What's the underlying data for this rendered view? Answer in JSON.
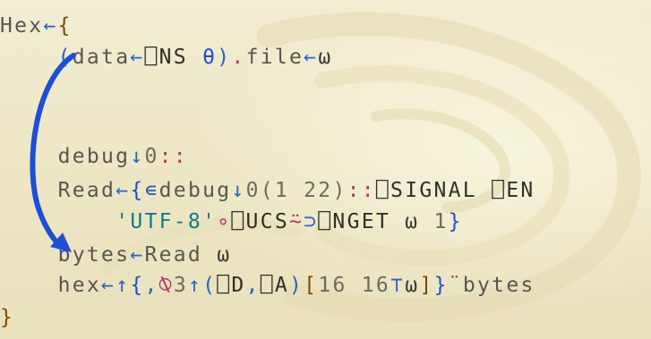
{
  "code": {
    "lines": [
      {
        "segments": [
          {
            "t": "Hex",
            "c": "t-id"
          },
          {
            "t": "←",
            "c": "t-prim"
          },
          {
            "t": "{",
            "c": "t-brace"
          }
        ]
      },
      {
        "segments": [
          {
            "t": "    (",
            "c": "t-prim"
          },
          {
            "t": "data",
            "c": "t-id"
          },
          {
            "t": "←",
            "c": "t-prim"
          },
          {
            "t": "⎕NS",
            "c": "t-sys"
          },
          {
            "t": " ",
            "c": "t-id"
          },
          {
            "t": "θ",
            "c": "t-theta"
          },
          {
            "t": ")",
            "c": "t-prim"
          },
          {
            "t": ".",
            "c": "t-op"
          },
          {
            "t": "file",
            "c": "t-id"
          },
          {
            "t": "←",
            "c": "t-prim"
          },
          {
            "t": "ω",
            "c": "t-name"
          }
        ]
      },
      {
        "segments": [
          {
            "t": "",
            "c": "t-id"
          }
        ]
      },
      {
        "segments": [
          {
            "t": "",
            "c": "t-id"
          }
        ]
      },
      {
        "segments": [
          {
            "t": "",
            "c": "t-id"
          }
        ]
      },
      {
        "segments": [
          {
            "t": "    debug",
            "c": "t-id"
          },
          {
            "t": "↓",
            "c": "t-prim"
          },
          {
            "t": "0",
            "c": "t-num"
          },
          {
            "t": "::",
            "c": "t-op"
          }
        ]
      },
      {
        "segments": [
          {
            "t": "    Read",
            "c": "t-id"
          },
          {
            "t": "←",
            "c": "t-prim"
          },
          {
            "t": "{",
            "c": "t-brace-inner"
          },
          {
            "t": "∊",
            "c": "t-prim"
          },
          {
            "t": "debug",
            "c": "t-id"
          },
          {
            "t": "↓",
            "c": "t-prim"
          },
          {
            "t": "0",
            "c": "t-num"
          },
          {
            "t": "(1 22)",
            "c": "t-num"
          },
          {
            "t": "::",
            "c": "t-op"
          },
          {
            "t": "⎕SIGNAL ⎕EN",
            "c": "t-sys"
          }
        ]
      },
      {
        "segments": [
          {
            "t": "        ",
            "c": "t-id"
          },
          {
            "t": "'UTF-8'",
            "c": "t-str"
          },
          {
            "t": "∘",
            "c": "t-op"
          },
          {
            "t": "⎕UCS",
            "c": "t-sys"
          },
          {
            "t": "⍨",
            "c": "t-op"
          },
          {
            "t": "⊃",
            "c": "t-prim"
          },
          {
            "t": "⎕NGET",
            "c": "t-sys"
          },
          {
            "t": " ω ",
            "c": "t-name"
          },
          {
            "t": "1",
            "c": "t-num"
          },
          {
            "t": "}",
            "c": "t-brace-inner"
          }
        ]
      },
      {
        "segments": [
          {
            "t": "    bytes",
            "c": "t-id"
          },
          {
            "t": "←",
            "c": "t-prim"
          },
          {
            "t": "Read",
            "c": "t-id"
          },
          {
            "t": " ω",
            "c": "t-name"
          }
        ]
      },
      {
        "segments": [
          {
            "t": "    hex",
            "c": "t-id"
          },
          {
            "t": "←",
            "c": "t-prim"
          },
          {
            "t": "↑",
            "c": "t-prim"
          },
          {
            "t": "{",
            "c": "t-brace-inner"
          },
          {
            "t": ",",
            "c": "t-prim"
          },
          {
            "t": "⍉",
            "c": "t-op"
          },
          {
            "t": "3",
            "c": "t-num"
          },
          {
            "t": "↑",
            "c": "t-prim"
          },
          {
            "t": "(",
            "c": "t-prim"
          },
          {
            "t": "⎕D",
            "c": "t-sys"
          },
          {
            "t": ",",
            "c": "t-prim"
          },
          {
            "t": "⎕A",
            "c": "t-sys"
          },
          {
            "t": ")",
            "c": "t-prim"
          },
          {
            "t": "[",
            "c": "t-brace"
          },
          {
            "t": "16 16",
            "c": "t-num"
          },
          {
            "t": "⊤",
            "c": "t-prim"
          },
          {
            "t": "ω",
            "c": "t-name"
          },
          {
            "t": "]",
            "c": "t-brace"
          },
          {
            "t": "}",
            "c": "t-brace-inner"
          },
          {
            "t": "¨",
            "c": "t-op"
          },
          {
            "t": "bytes",
            "c": "t-id"
          }
        ]
      },
      {
        "segments": [
          {
            "t": "}",
            "c": "t-brace"
          }
        ]
      }
    ]
  },
  "colors": {
    "background": "#efe9c9",
    "arrow": "#1d4ed8"
  }
}
